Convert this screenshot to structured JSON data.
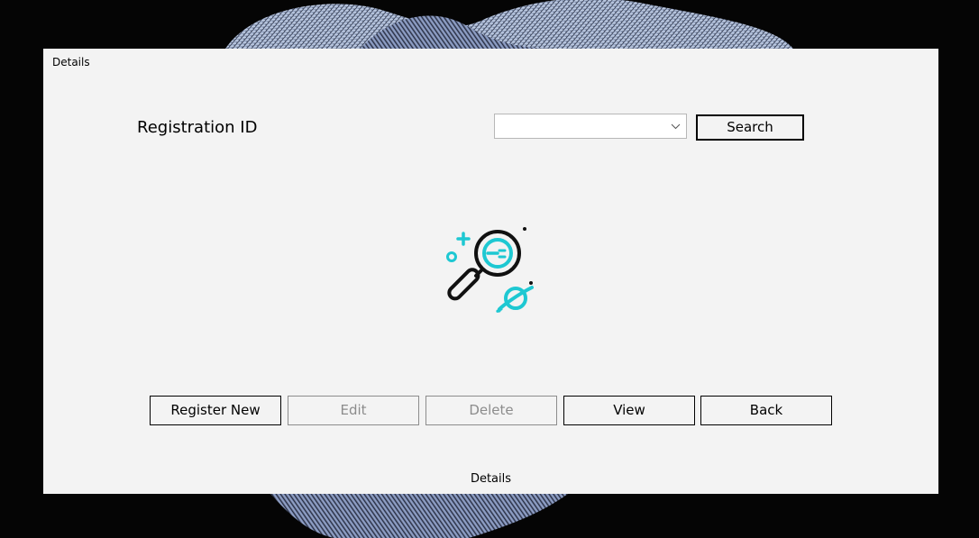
{
  "window": {
    "title": "Details"
  },
  "form": {
    "registration_label": "Registration ID",
    "registration_value": "",
    "search_label": "Search"
  },
  "actions": {
    "register_new": "Register New",
    "edit": "Edit",
    "delete": "Delete",
    "view": "View",
    "back": "Back"
  },
  "status": {
    "text": "Details"
  },
  "icons": {
    "illustration": "magnifier-planet-icon",
    "dropdown": "chevron-down-icon"
  },
  "colors": {
    "accent": "#1ec8d2",
    "window_bg": "#f3f3f3",
    "desktop_bg": "#050505",
    "disabled_text": "#8c8c8c"
  },
  "button_states": {
    "edit_enabled": false,
    "delete_enabled": false
  }
}
